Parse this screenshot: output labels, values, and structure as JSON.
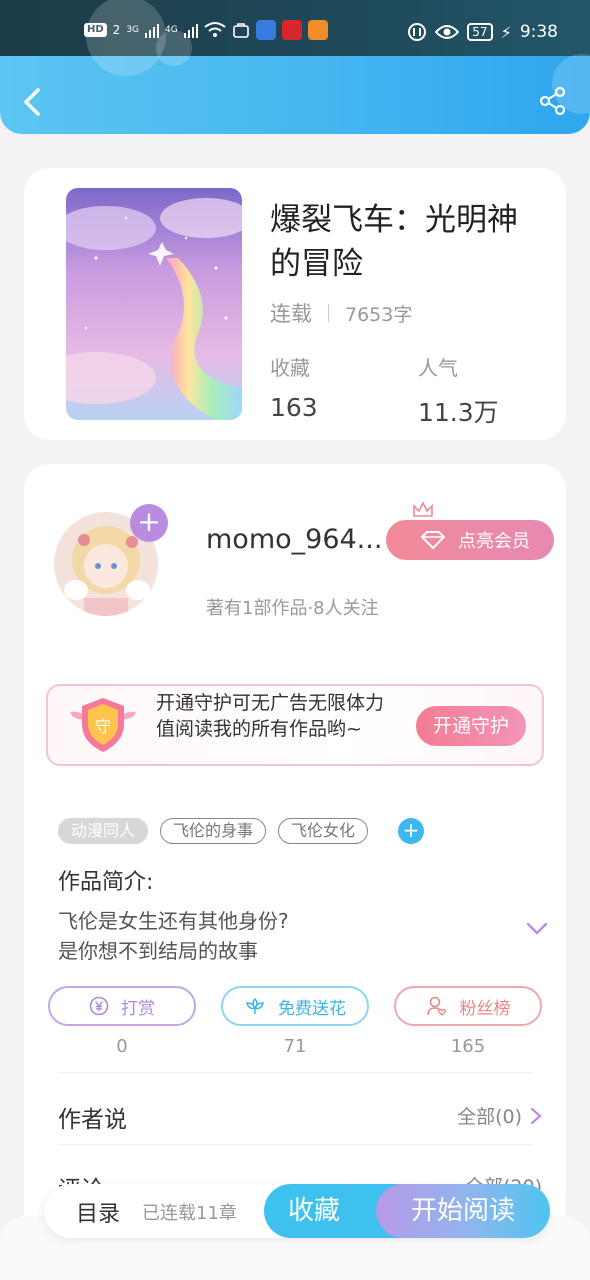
{
  "status_bar": {
    "network_hd": "HD",
    "network_2": "2",
    "sig1": "3G",
    "sig2": "4G",
    "battery": "57",
    "time": "9:38"
  },
  "book": {
    "title": "爆裂飞车：光明神的冒险",
    "status": "连载",
    "word_count": "7653字",
    "favorites_label": "收藏",
    "favorites_value": "163",
    "popularity_label": "人气",
    "popularity_value": "11.3万"
  },
  "author": {
    "name": "momo_964...",
    "vip_button": "点亮会员",
    "subtitle": "著有1部作品·8人关注",
    "guard_text": "开通守护可无广告无限体力值阅读我的所有作品哟~",
    "guard_button": "开通守护",
    "guard_icon_char": "守"
  },
  "tags": [
    "动漫同人",
    "飞伦的身事",
    "飞伦女化"
  ],
  "intro": {
    "title": "作品简介:",
    "line1": "飞伦是女生还有其他身份?",
    "line2": "是你想不到结局的故事"
  },
  "actions": {
    "reward_label": "打赏",
    "reward_count": "0",
    "flower_label": "免费送花",
    "flower_count": "71",
    "fans_label": "粉丝榜",
    "fans_count": "165"
  },
  "sections": {
    "author_says": "作者说",
    "author_says_all": "全部(0)",
    "comments": "评论",
    "comments_all": "全部(20)"
  },
  "bottom_bar": {
    "toc": "目录",
    "toc_sub": "已连载11章",
    "collect": "收藏",
    "read": "开始阅读"
  },
  "colors": {
    "accent_blue": "#3ec1ee",
    "accent_purple": "#b98ce0",
    "accent_pink": "#f37d92"
  }
}
